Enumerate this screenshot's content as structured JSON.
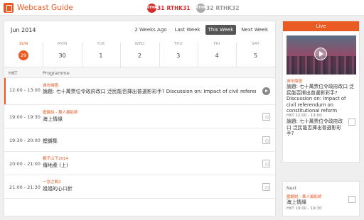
{
  "app": {
    "title": "Webcast Guide",
    "accent": "#ea5b24"
  },
  "channels": [
    {
      "badge": "RTHK",
      "num": "31",
      "name": "RTHK31"
    },
    {
      "badge": "RTHK",
      "num": "32",
      "name": "RTHK32"
    }
  ],
  "schedule": {
    "month": "Jun 2014",
    "nav": [
      "2 Weeks Ago",
      "Last Week",
      "This Week",
      "Next Week"
    ],
    "days": [
      {
        "label": "SUN",
        "num": "29"
      },
      {
        "label": "MON",
        "num": "30"
      },
      {
        "label": "TUE",
        "num": "1"
      },
      {
        "label": "WED",
        "num": "2"
      },
      {
        "label": "THU",
        "num": "3"
      },
      {
        "label": "FRI",
        "num": "4"
      },
      {
        "label": "SAT",
        "num": "5"
      }
    ],
    "headers": {
      "time": "HKT",
      "programme": "Programme"
    },
    "rows": [
      {
        "time": "12:00 - 13:00",
        "category": "城市論壇",
        "title": "論題: 七十萬票位令政府改口 泛民能否揮出普選影彩手? Discussion on: Impact of civil referendu..."
      },
      {
        "time": "19:00 - 19:30",
        "category": "鏗鏘說 - 華人攝影師",
        "title": "海上情緣"
      },
      {
        "time": "19:30 - 20:00",
        "category": "",
        "title": "鏗鏘集"
      },
      {
        "time": "20:00 - 21:00",
        "category": "獅子山下2014",
        "title": "傳地產 (上)"
      },
      {
        "time": "21:00 - 21:30",
        "category": "一念之間2",
        "title": "姐姐的心口針"
      }
    ]
  },
  "live": {
    "header": "Live",
    "category": "城市論壇",
    "title": "論題: 七十萬票位令政府改口 泛民能否揮出普選影彩手? Discussion on: Impact of civil referendum on constitutional reform",
    "time": "HKT 12:00 - 13:00",
    "desc": "論題: 七十萬票位令政府改口 泛民能否揮出普選影彩手?"
  },
  "next": {
    "label": "Next",
    "category": "鏗鏘說 - 華人攝影師",
    "title": "海上情緣",
    "time": "HKT 19:00 - 19:30"
  }
}
